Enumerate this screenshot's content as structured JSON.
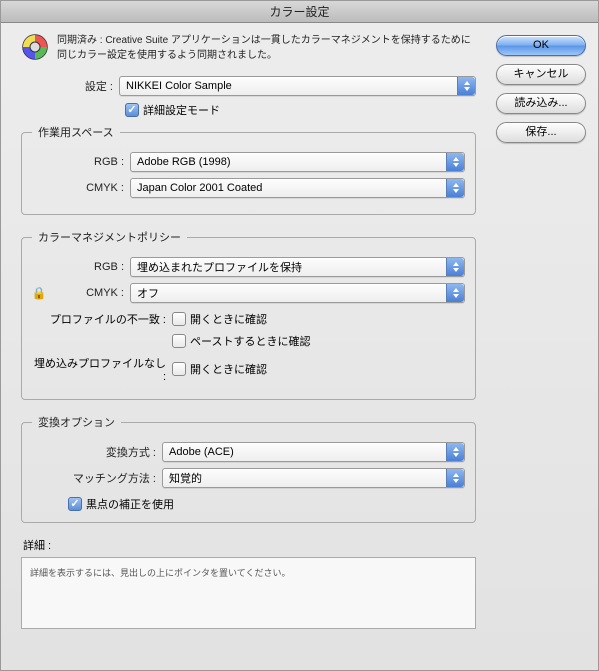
{
  "title": "カラー設定",
  "sync": {
    "text": "同期済み : Creative Suite アプリケーションは一貫したカラーマネジメントを保持するために同じカラー設定を使用するよう同期されました。"
  },
  "buttons": {
    "ok": "OK",
    "cancel": "キャンセル",
    "load": "読み込み...",
    "save": "保存..."
  },
  "settings": {
    "label": "設定 :",
    "value": "NIKKEI Color Sample",
    "advanced_label": "詳細設定モード"
  },
  "workspace": {
    "legend": "作業用スペース",
    "rgb_label": "RGB :",
    "rgb_value": "Adobe RGB (1998)",
    "cmyk_label": "CMYK :",
    "cmyk_value": "Japan Color 2001 Coated"
  },
  "policy": {
    "legend": "カラーマネジメントポリシー",
    "rgb_label": "RGB :",
    "rgb_value": "埋め込まれたプロファイルを保持",
    "cmyk_label": "CMYK :",
    "cmyk_value": "オフ",
    "mismatch_label": "プロファイルの不一致 :",
    "mismatch_open": "開くときに確認",
    "mismatch_paste": "ペーストするときに確認",
    "missing_label": "埋め込みプロファイルなし :",
    "missing_open": "開くときに確認"
  },
  "conversion": {
    "legend": "変換オプション",
    "engine_label": "変換方式 :",
    "engine_value": "Adobe (ACE)",
    "intent_label": "マッチング方法 :",
    "intent_value": "知覚的",
    "blackpoint_label": "黒点の補正を使用"
  },
  "details": {
    "label": "詳細 :",
    "hint": "詳細を表示するには、見出しの上にポインタを置いてください。"
  }
}
